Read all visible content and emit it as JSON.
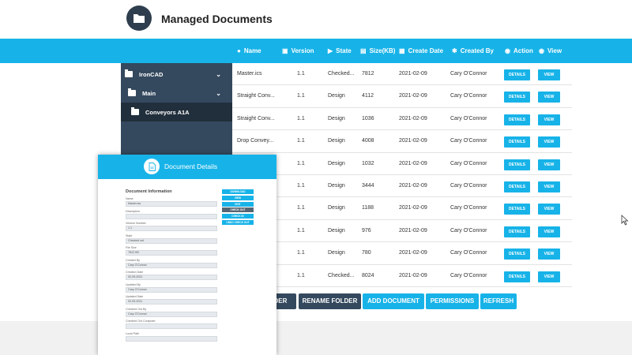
{
  "header": {
    "title": "Managed Documents",
    "icon": "folder-icon"
  },
  "columns": [
    {
      "label": "Name",
      "icon": "user-icon"
    },
    {
      "label": "Version",
      "icon": "lock-icon"
    },
    {
      "label": "State",
      "icon": "play-icon"
    },
    {
      "label": "Size(KB)",
      "icon": "document-icon"
    },
    {
      "label": "Create Date",
      "icon": "calendar-icon"
    },
    {
      "label": "Created By",
      "icon": "gear-icon"
    },
    {
      "label": "Action",
      "icon": "eye-icon"
    },
    {
      "label": "View",
      "icon": "eye-icon"
    }
  ],
  "tree": [
    {
      "label": "IronCAD",
      "expanded": true
    },
    {
      "label": "Main",
      "expanded": true
    },
    {
      "label": "Conveyors A1A",
      "selected": true
    }
  ],
  "rows": [
    {
      "name": "Master.ics",
      "version": "1.1",
      "state": "Checked...",
      "size": "7812",
      "date": "2021-02-09",
      "by": "Cary O'Connor"
    },
    {
      "name": "Straight Conv...",
      "version": "1.1",
      "state": "Design",
      "size": "4112",
      "date": "2021-02-09",
      "by": "Cary O'Connor"
    },
    {
      "name": "Straight Conv...",
      "version": "1.1",
      "state": "Design",
      "size": "1036",
      "date": "2021-02-09",
      "by": "Cary O'Connor"
    },
    {
      "name": "Drop Convey...",
      "version": "1.1",
      "state": "Design",
      "size": "4008",
      "date": "2021-02-09",
      "by": "Cary O'Connor"
    },
    {
      "name": "",
      "version": "1.1",
      "state": "Design",
      "size": "1032",
      "date": "2021-02-09",
      "by": "Cary O'Connor"
    },
    {
      "name": "",
      "version": "1.1",
      "state": "Design",
      "size": "3444",
      "date": "2021-02-09",
      "by": "Cary O'Connor"
    },
    {
      "name": "",
      "version": "1.1",
      "state": "Design",
      "size": "1188",
      "date": "2021-02-09",
      "by": "Cary O'Connor"
    },
    {
      "name": "",
      "version": "1.1",
      "state": "Design",
      "size": "976",
      "date": "2021-02-09",
      "by": "Cary O'Connor"
    },
    {
      "name": "",
      "version": "1.1",
      "state": "Design",
      "size": "780",
      "date": "2021-02-09",
      "by": "Cary O'Connor"
    },
    {
      "name": "",
      "version": "1.1",
      "state": "Checked...",
      "size": "8024",
      "date": "2021-02-09",
      "by": "Cary O'Connor"
    }
  ],
  "row_buttons": {
    "details": "DETAILS",
    "view": "VIEW"
  },
  "actions": {
    "partial_folder": "LDER",
    "rename_folder": "RENAME FOLDER",
    "add_document": "ADD DOCUMENT",
    "permissions": "PERMISSIONS",
    "refresh": "REFRESH"
  },
  "popup": {
    "title": "Document Details",
    "section": "Document Information",
    "fields": [
      {
        "label": "Name",
        "value": "Master.ics"
      },
      {
        "label": "Description",
        "value": ""
      },
      {
        "label": "Version Number",
        "value": "1.1"
      },
      {
        "label": "State",
        "value": "Checked out"
      },
      {
        "label": "File Size",
        "value": "7812 KB"
      },
      {
        "label": "Created By",
        "value": "Cary O'Connor"
      },
      {
        "label": "Creation Date",
        "value": "02-09-2021"
      },
      {
        "label": "Updated By",
        "value": "Cary O'Connor"
      },
      {
        "label": "Updated Date",
        "value": "02-09-2021"
      },
      {
        "label": "Checked Out By",
        "value": "Cary O'Connor"
      },
      {
        "label": "Checked Out Computer",
        "value": ""
      },
      {
        "label": "Local Path",
        "value": ""
      }
    ],
    "buttons": [
      {
        "label": "DOWNLOAD",
        "style": "cyan"
      },
      {
        "label": "VIEW",
        "style": "cyan"
      },
      {
        "label": "EDIT",
        "style": "cyan"
      },
      {
        "label": "CHECK OUT",
        "style": "dark"
      },
      {
        "label": "CHECK IN",
        "style": "cyan"
      },
      {
        "label": "UNDO CHECK OUT",
        "style": "cyan"
      }
    ]
  },
  "colors": {
    "accent": "#17b3e8",
    "sidebar": "#34495e",
    "sidebar_selected": "#212f3c"
  }
}
